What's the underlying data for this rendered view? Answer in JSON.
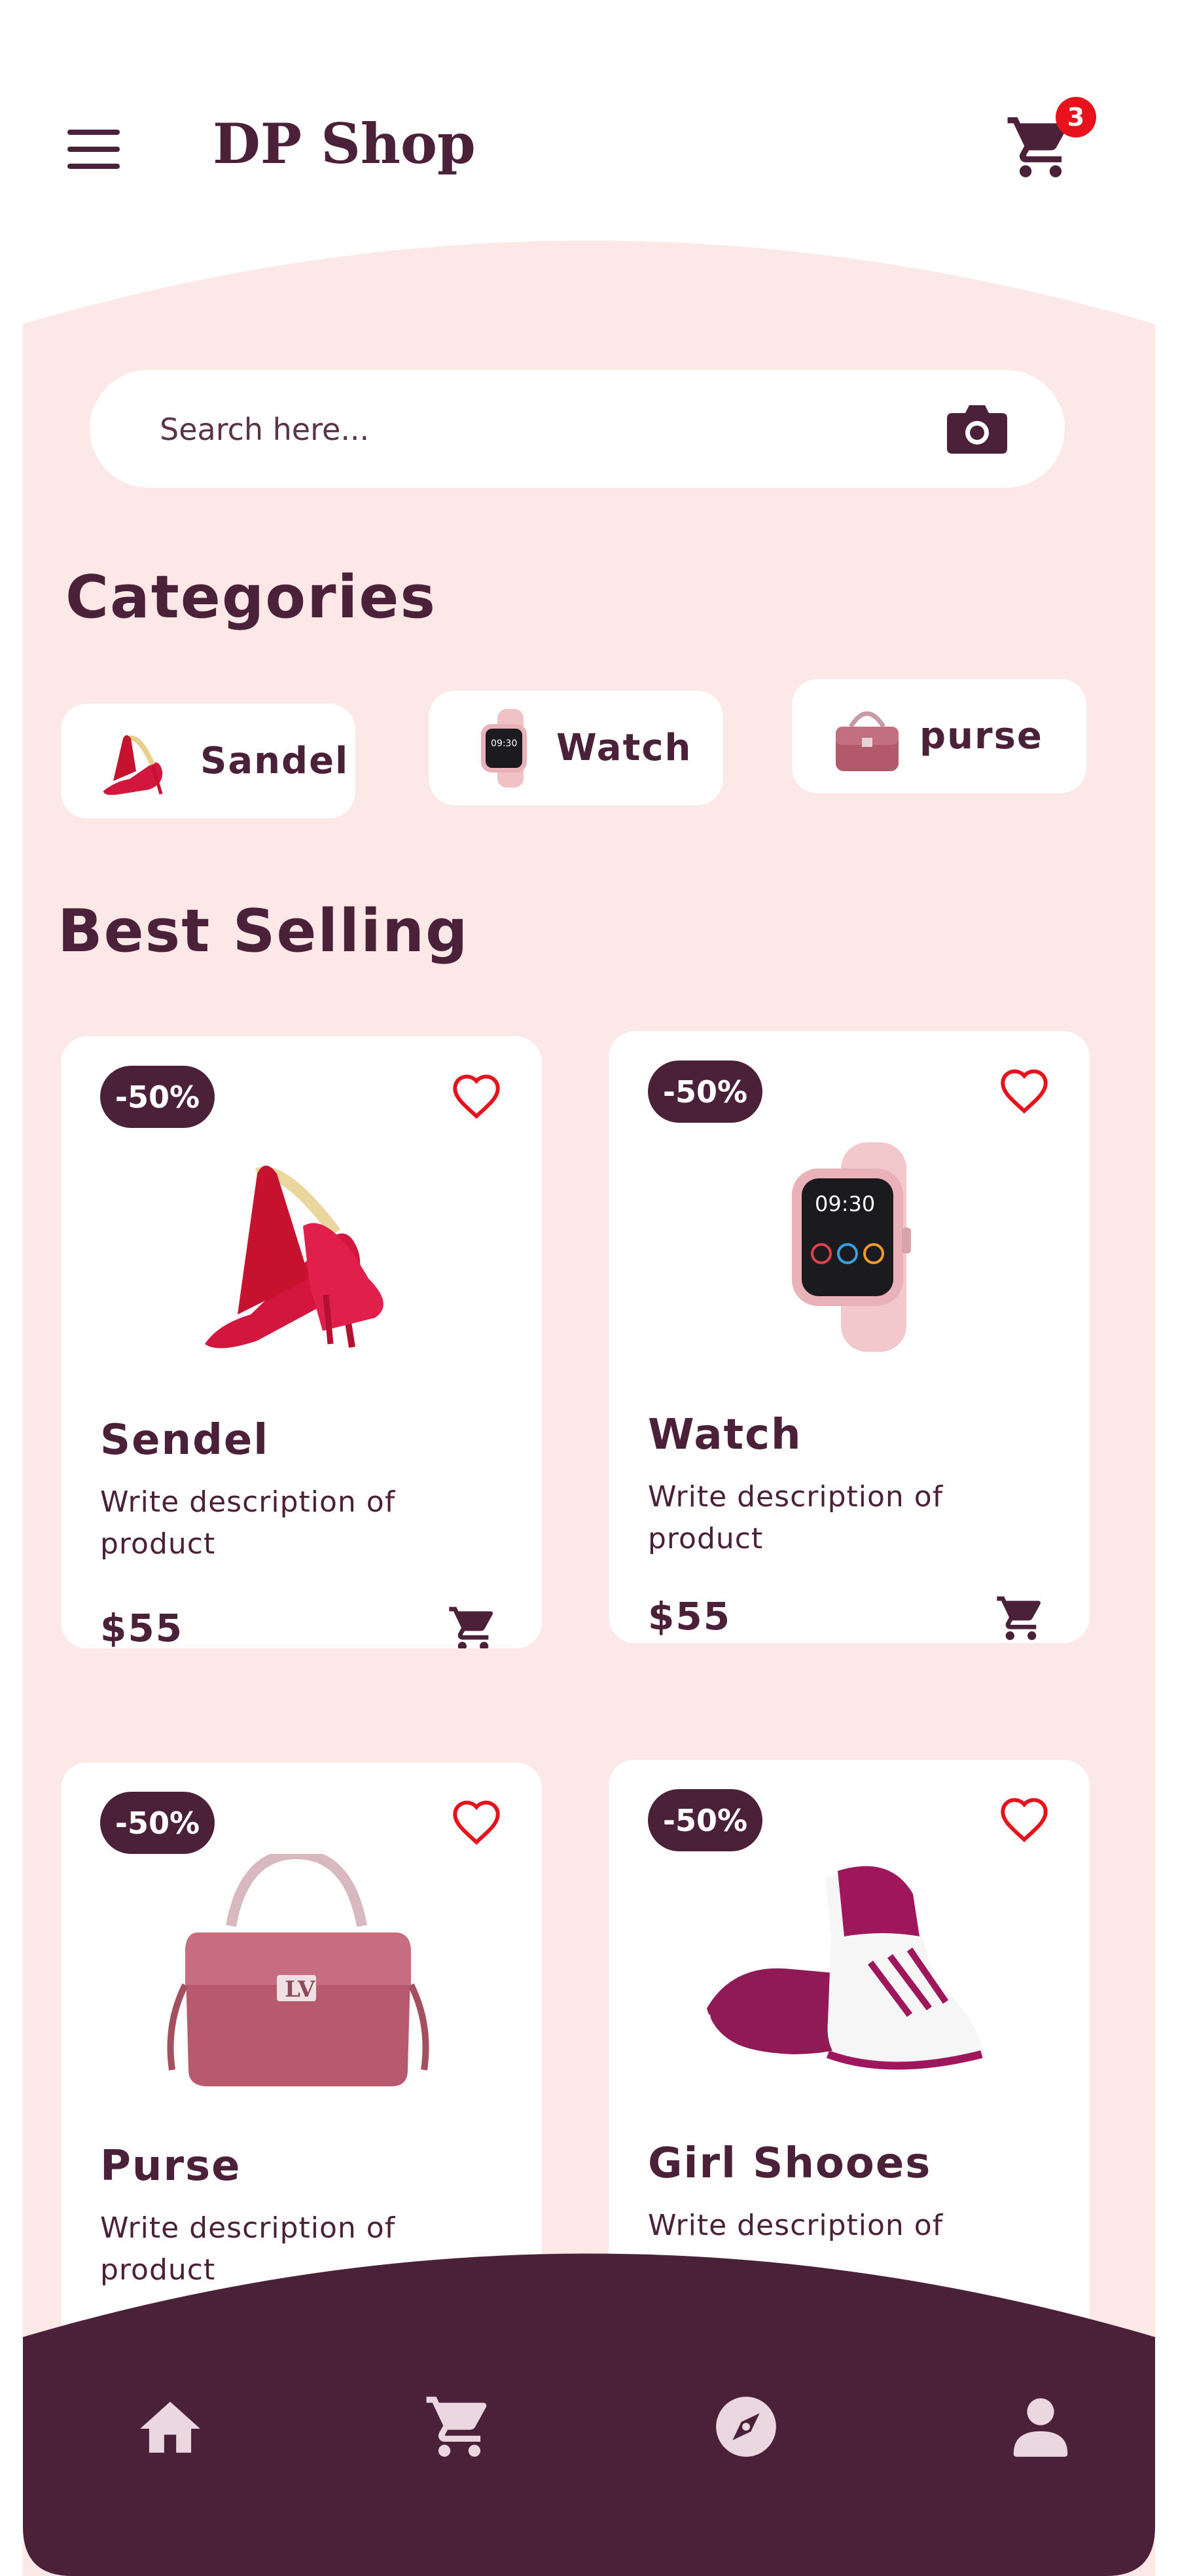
{
  "header": {
    "title": "DP Shop",
    "cart_count": "3"
  },
  "search": {
    "placeholder": "Search here..."
  },
  "categories": {
    "title": "Categories",
    "items": [
      {
        "label": "Sandel",
        "icon": "heels-icon"
      },
      {
        "label": "Watch",
        "icon": "watch-icon"
      },
      {
        "label": "purse",
        "icon": "purse-icon"
      }
    ]
  },
  "best_selling": {
    "title": "Best Selling",
    "products": [
      {
        "discount": "-50%",
        "name": "Sendel",
        "description": "Write description of product",
        "price": "$55",
        "image": "heels-icon"
      },
      {
        "discount": "-50%",
        "name": "Watch",
        "description": "Write description of product",
        "price": "$55",
        "image": "watch-icon"
      },
      {
        "discount": "-50%",
        "name": "Purse",
        "description": "Write description of product",
        "image": "purse-icon"
      },
      {
        "discount": "-50%",
        "name": "Girl Shooes",
        "description": "Write description of",
        "image": "sneaker-icon"
      }
    ]
  },
  "bottom_nav": {
    "items": [
      {
        "icon": "home-icon"
      },
      {
        "icon": "cart-icon"
      },
      {
        "icon": "compass-icon"
      },
      {
        "icon": "profile-icon"
      }
    ]
  },
  "colors": {
    "primary": "#4b2039",
    "background_pink": "#fde8e8",
    "badge_red": "#e8121c",
    "heart_red": "#e8121c",
    "nav_icon": "#ead7df"
  }
}
